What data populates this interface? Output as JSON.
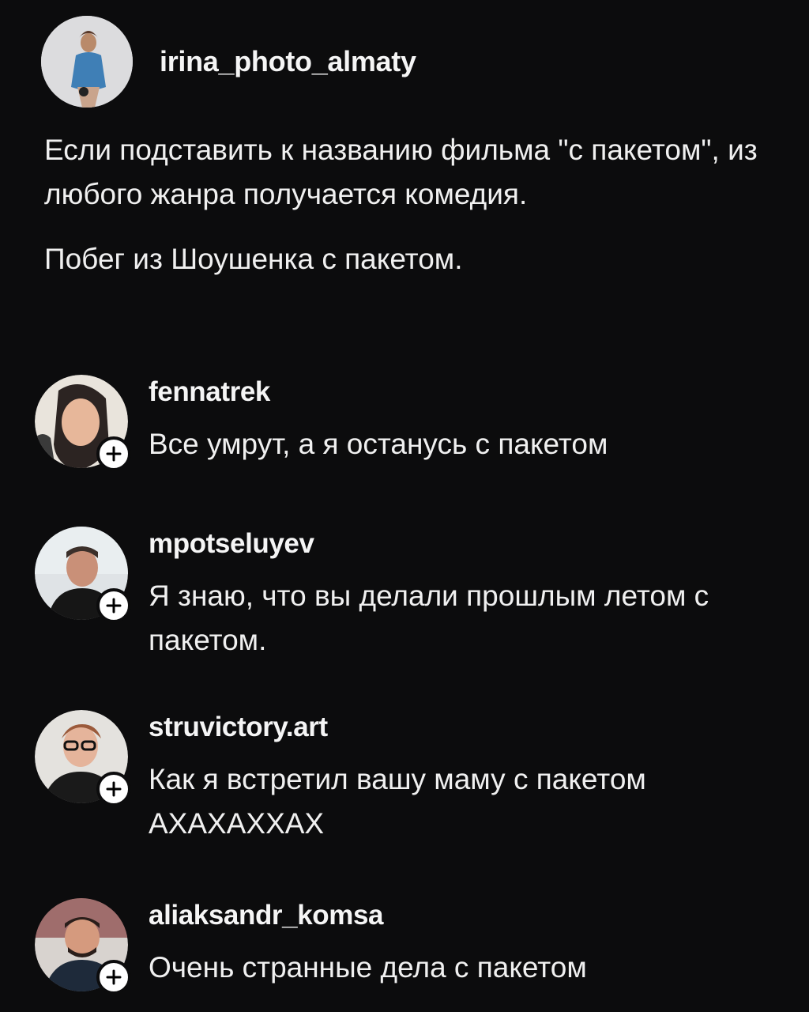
{
  "post": {
    "author": "irina_photo_almaty",
    "paragraphs": [
      "Если подставить к названию фильма \"с пакетом\", из любого жанра получается комедия.",
      "Побег из Шоушенка с пакетом."
    ]
  },
  "comments": [
    {
      "username": "fennatrek",
      "text": "Все умрут, а я останусь с пакетом"
    },
    {
      "username": "mpotseluyev",
      "text": "Я знаю, что вы делали прошлым летом с пакетом."
    },
    {
      "username": "struvictory.art",
      "text": "Как я встретил вашу маму с пакетом АХАХАХХАХ"
    },
    {
      "username": "aliaksandr_komsa",
      "text": "Очень странные дела с пакетом"
    }
  ],
  "icons": {
    "follow": "plus-icon"
  },
  "colors": {
    "background": "#0c0c0d",
    "text": "#f0f0f0",
    "badge": "#ffffff"
  }
}
